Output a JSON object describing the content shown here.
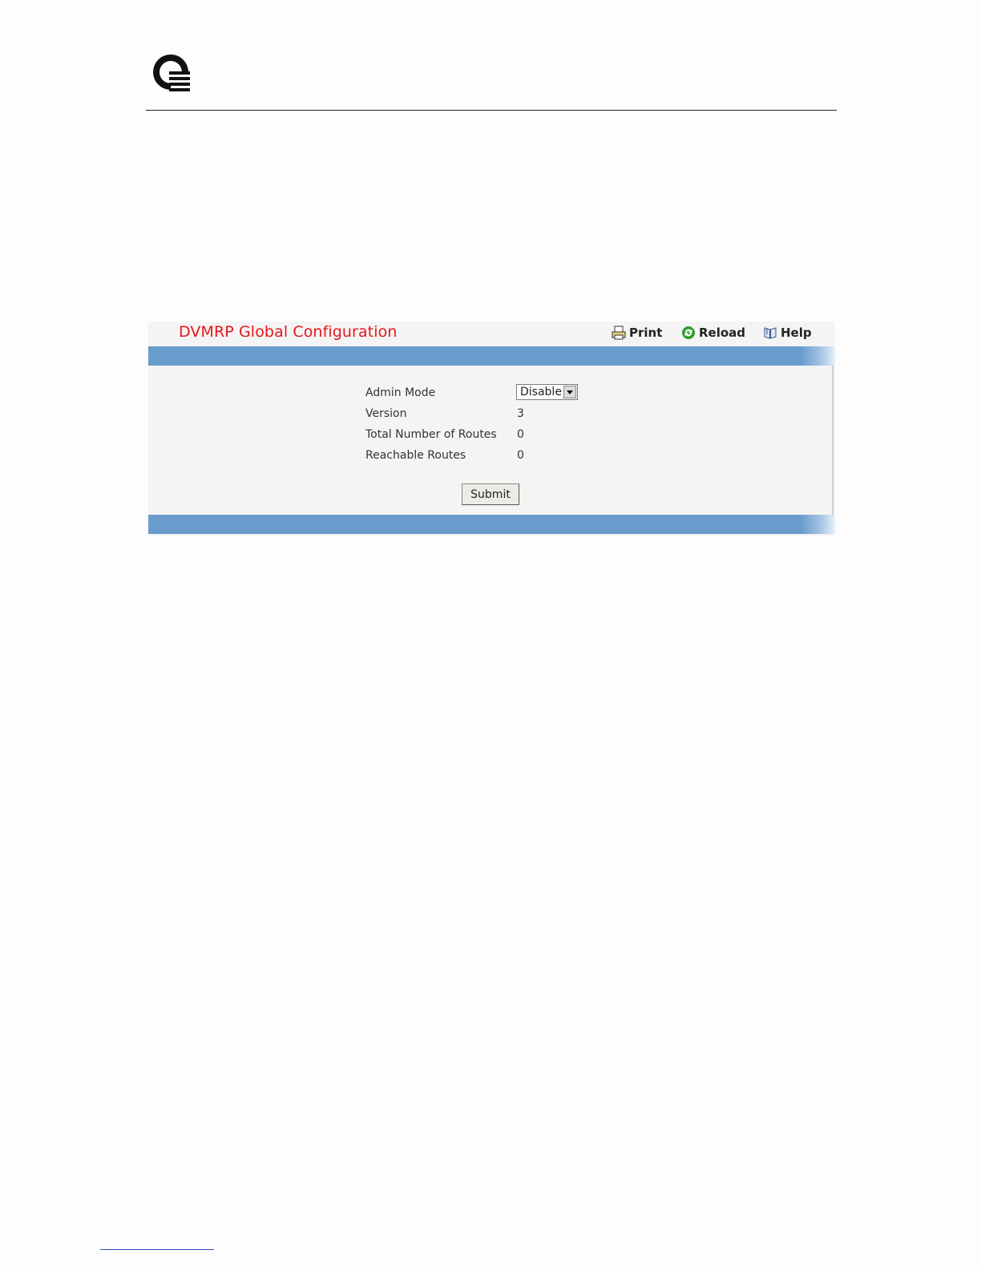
{
  "panel": {
    "title": "DVMRP Global Configuration"
  },
  "toolbar": {
    "print_label": "Print",
    "reload_label": "Reload",
    "help_label": "Help"
  },
  "form": {
    "fields": [
      {
        "label": "Admin Mode",
        "value": "Disable"
      },
      {
        "label": "Version",
        "value": "3"
      },
      {
        "label": "Total Number of Routes",
        "value": "0"
      },
      {
        "label": "Reachable Routes",
        "value": "0"
      }
    ],
    "submit_label": "Submit"
  },
  "icons": {
    "logo": "company-logo-icon",
    "print": "printer-icon",
    "reload": "reload-icon",
    "help": "help-book-icon"
  },
  "colors": {
    "title": "#e8161b",
    "band": "#6a9bcd",
    "reload_icon": "#2f9d2f"
  }
}
